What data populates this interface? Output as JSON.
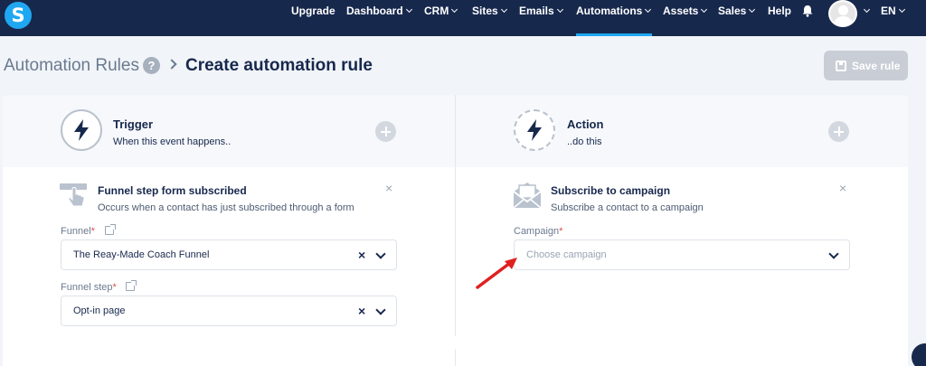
{
  "nav": {
    "logo": "S",
    "items": [
      {
        "label": "Upgrade",
        "dropdown": false
      },
      {
        "label": "Dashboard",
        "dropdown": true
      },
      {
        "label": "CRM",
        "dropdown": true
      },
      {
        "label": "Sites",
        "dropdown": true
      },
      {
        "label": "Emails",
        "dropdown": true
      },
      {
        "label": "Automations",
        "dropdown": true
      },
      {
        "label": "Assets",
        "dropdown": true
      },
      {
        "label": "Sales",
        "dropdown": true
      },
      {
        "label": "Help",
        "dropdown": false
      }
    ],
    "active": "Automations",
    "lang": "EN",
    "icons": {
      "notifications": "bell-icon",
      "user": "avatar"
    }
  },
  "header": {
    "breadcrumb_root": "Automation Rules",
    "help_glyph": "?",
    "title": "Create automation rule",
    "save_label": "Save rule"
  },
  "trigger": {
    "title": "Trigger",
    "subtitle": "When this event happens..",
    "card": {
      "title": "Funnel step form subscribed",
      "description": "Occurs when a contact has just subscribed through a form",
      "fields": [
        {
          "label": "Funnel",
          "required": "*",
          "value": "The Reay-Made Coach Funnel"
        },
        {
          "label": "Funnel step",
          "required": "*",
          "value": "Opt-in page"
        }
      ]
    }
  },
  "action": {
    "title": "Action",
    "subtitle": "..do this",
    "card": {
      "title": "Subscribe to campaign",
      "description": "Subscribe a contact to a campaign",
      "field": {
        "label": "Campaign",
        "required": "*",
        "placeholder": "Choose campaign"
      }
    }
  },
  "glyphs": {
    "clear": "×",
    "close": "×"
  },
  "colors": {
    "nav_bg": "#17284d",
    "accent": "#1fa8f1",
    "annotation": "#e02020"
  }
}
